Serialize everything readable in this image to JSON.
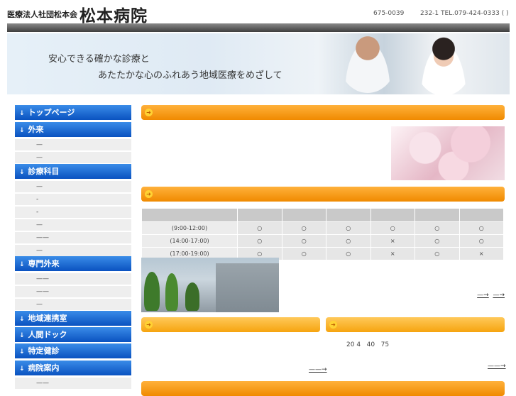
{
  "header": {
    "org_name": "医療法人社団松本会",
    "hospital_name": "松本病院",
    "zip": "675-0039",
    "address_tel": "232-1 TEL.079-424-0333 ( )"
  },
  "hero": {
    "line1": "安心できる確かな診療と",
    "line2": "あたたかな心のふれあう地域医療をめざして"
  },
  "nav": {
    "arrow": "↓",
    "top_page": "トップページ",
    "outpatient": "外来",
    "outpatient_sub": [
      "—",
      "—"
    ],
    "departments": "診療科目",
    "departments_sub": [
      "—",
      "-",
      "-",
      "—",
      "——",
      "—"
    ],
    "specialty": "専門外来",
    "specialty_sub": [
      "——",
      "——",
      "—"
    ],
    "community": "地域連携室",
    "dock": "人間ドック",
    "checkup": "特定健診",
    "guide": "病院案内",
    "guide_sub": [
      "——"
    ]
  },
  "content": {
    "bar_icon": "➜",
    "hours": {
      "rows": [
        {
          "label": "(9:00-12:00)",
          "cells": [
            "○",
            "○",
            "○",
            "○",
            "○",
            "○"
          ]
        },
        {
          "label": "(14:00-17:00)",
          "cells": [
            "○",
            "○",
            "○",
            "×",
            "○",
            "○"
          ]
        },
        {
          "label": "(17:00-19:00)",
          "cells": [
            "○",
            "○",
            "○",
            "×",
            "○",
            "×"
          ]
        }
      ]
    },
    "link1": "—→",
    "link2": "—→",
    "stats": "20 4   40   75",
    "more_left": "——→",
    "more_right": "——→"
  }
}
